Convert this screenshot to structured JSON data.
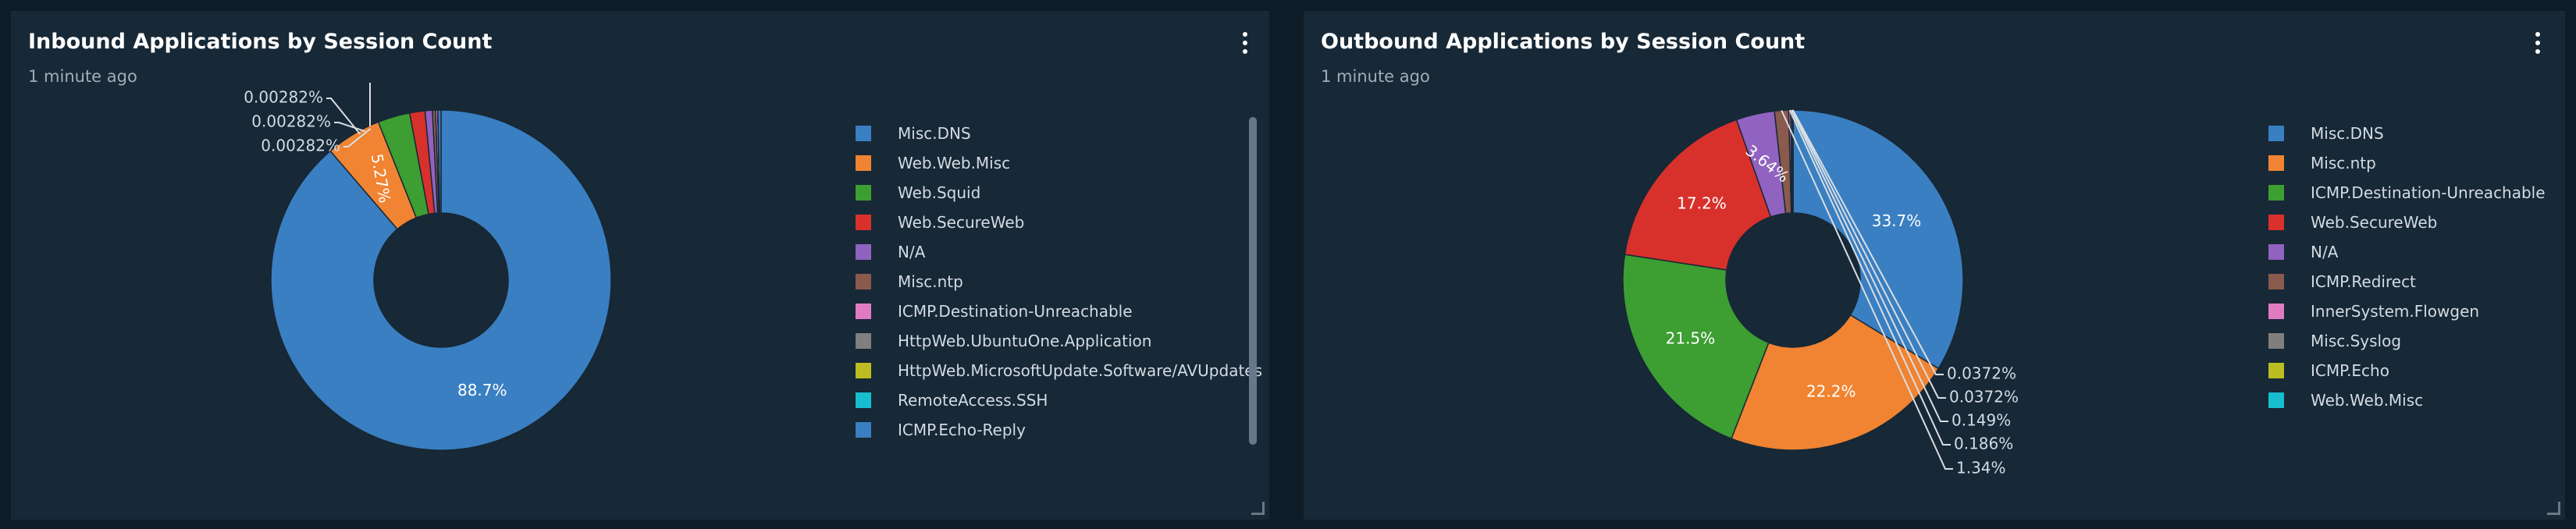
{
  "colors": {
    "background": "#0e1c28",
    "panel": "#172836"
  },
  "panels": [
    {
      "title": "Inbound Applications by Session Count",
      "subtitle": "1 minute ago"
    },
    {
      "title": "Outbound Applications by Session Count",
      "subtitle": "1 minute ago"
    }
  ],
  "chart_data": [
    {
      "type": "pie",
      "donut": true,
      "title": "Inbound Applications by Session Count",
      "legend": "right",
      "categories": [
        "Misc.DNS",
        "Web.Web.Misc",
        "Web.Squid",
        "Web.SecureWeb",
        "N/A",
        "Misc.ntp",
        "ICMP.Destination-Unreachable",
        "HttpWeb.UbuntuOne.Application",
        "HttpWeb.MicrosoftUpdate.Software/AVUpdates",
        "RemoteAccess.SSH",
        "ICMP.Echo-Reply"
      ],
      "values": [
        88.7,
        5.27,
        3.05,
        1.45,
        0.7,
        0.3,
        0.2,
        0.00282,
        0.00282,
        0.00282,
        0.3
      ],
      "colors": [
        "#3a7fc1",
        "#f08432",
        "#3d9e32",
        "#d8312c",
        "#9163c0",
        "#8a5a4d",
        "#e07bc2",
        "#7f7f7f",
        "#bcbd22",
        "#17becf",
        "#3a7fc1"
      ],
      "slice_labels": [
        "88.7%",
        "5.27%"
      ],
      "callout_labels": [
        "0.00282%",
        "0.00282%",
        "0.00282%"
      ]
    },
    {
      "type": "pie",
      "donut": true,
      "title": "Outbound Applications by Session Count",
      "legend": "right",
      "categories": [
        "Misc.DNS",
        "Misc.ntp",
        "ICMP.Destination-Unreachable",
        "Web.SecureWeb",
        "N/A",
        "ICMP.Redirect",
        "InnerSystem.Flowgen",
        "Misc.Syslog",
        "ICMP.Echo",
        "Web.Web.Misc"
      ],
      "values": [
        33.7,
        22.2,
        21.5,
        17.2,
        3.64,
        1.34,
        0.186,
        0.149,
        0.0372,
        0.0372
      ],
      "colors": [
        "#3a7fc1",
        "#f08432",
        "#3d9e32",
        "#d8312c",
        "#9163c0",
        "#8a5a4d",
        "#e07bc2",
        "#7f7f7f",
        "#bcbd22",
        "#17becf"
      ],
      "slice_labels": [
        "33.7%",
        "22.2%",
        "21.5%",
        "17.2%",
        "3.64%"
      ],
      "callout_labels": [
        "0.0372%",
        "0.0372%",
        "0.149%",
        "0.186%",
        "1.34%"
      ]
    }
  ]
}
